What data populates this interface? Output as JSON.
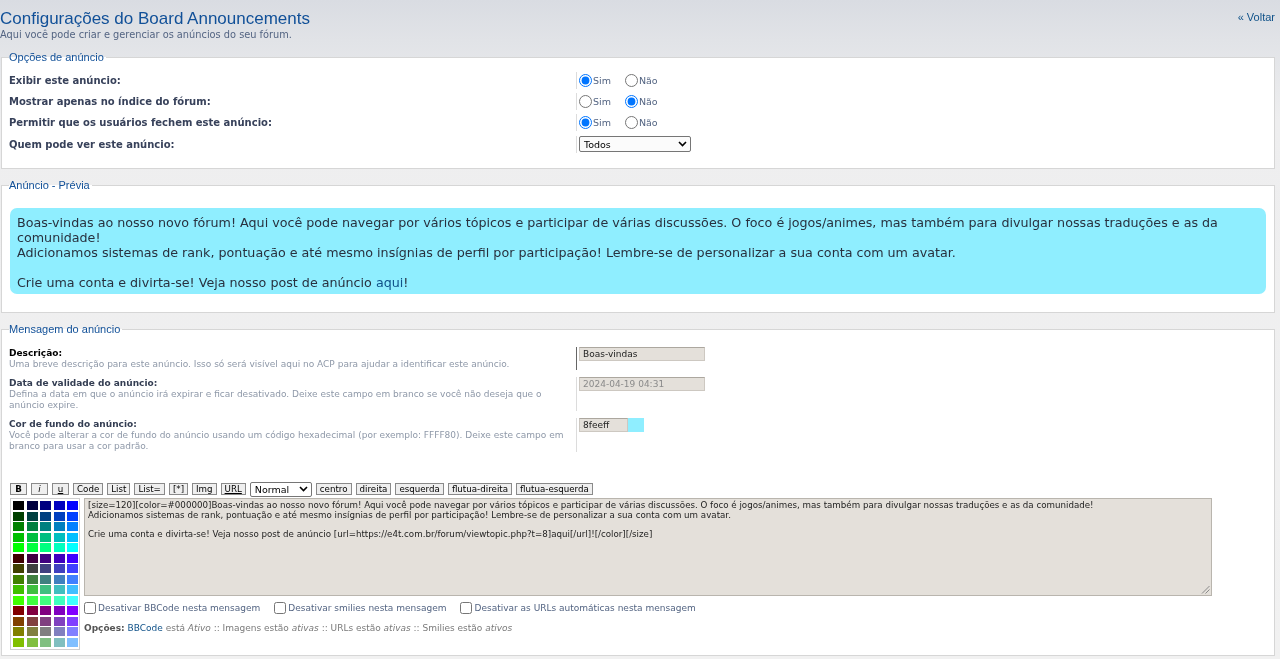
{
  "header": {
    "title": "Configurações do Board Announcements",
    "subtitle": "Aqui você pode criar e gerenciar os anúncios do seu fórum.",
    "back_link": "« Voltar"
  },
  "options": {
    "legend": "Opções de anúncio",
    "rows": [
      {
        "kind": "radio",
        "label": "Exibir este anúncio:",
        "choices": [
          {
            "label": "Sim",
            "selected": true
          },
          {
            "label": "Não",
            "selected": false
          }
        ]
      },
      {
        "kind": "radio",
        "label": "Mostrar apenas no índice do fórum:",
        "choices": [
          {
            "label": "Sim",
            "selected": false
          },
          {
            "label": "Não",
            "selected": true
          }
        ]
      },
      {
        "kind": "radio",
        "label": "Permitir que os usuários fechem este anúncio:",
        "choices": [
          {
            "label": "Sim",
            "selected": true
          },
          {
            "label": "Não",
            "selected": false
          }
        ]
      },
      {
        "kind": "select",
        "label": "Quem pode ver este anúncio:",
        "value": "Todos"
      }
    ]
  },
  "preview": {
    "legend": "Anúncio - Prévia",
    "color": "#8feeff",
    "lines": [
      "Boas-vindas ao nosso novo fórum! Aqui você pode navegar por vários tópicos e participar de várias discussões. O foco é jogos/animes, mas também para divulgar nossas traduções e as da comunidade!",
      "Adicionamos sistemas de rank, pontuação e até mesmo insígnias de perfil por participação! Lembre-se de personalizar a sua conta com um avatar."
    ],
    "closing": {
      "text": "Crie uma conta e divirta-se! Veja nosso post de anúncio",
      "link": "aqui",
      "after": "!"
    }
  },
  "message": {
    "legend": "Mensagem do anúncio",
    "fields": [
      {
        "label": "Descrição:",
        "hint": "Uma breve descrição para este anúncio. Isso só será visível aqui no ACP para ajudar a identificar este anúncio.",
        "value": "Boas-vindas",
        "hovered": true
      },
      {
        "label": "Data de validade do anúncio:",
        "hint": "Defina a data em que o anúncio irá expirar e ficar desativado. Deixe este campo em branco se você não deseja que o anúncio expire.",
        "placeholder": "2024-04-19 04:31",
        "hovered": false
      },
      {
        "label": "Cor de fundo do anúncio:",
        "hint": "Você pode alterar a cor de fundo do anúncio usando um código hexadecimal (por exemplo: FFFF80). Deixe este campo em branco para usar a cor padrão.",
        "value": "8feeff",
        "color": "#8feeff",
        "hovered": false
      }
    ],
    "toolbar": [
      {
        "kind": "bold",
        "label": "B"
      },
      {
        "kind": "italic",
        "label": "i"
      },
      {
        "kind": "underline",
        "label": "u"
      },
      {
        "kind": "plain",
        "label": "Code"
      },
      {
        "kind": "plain",
        "label": "List"
      },
      {
        "kind": "plain",
        "label": "List="
      },
      {
        "kind": "plain",
        "label": "[*]"
      },
      {
        "kind": "plain",
        "label": "Img"
      },
      {
        "kind": "underline",
        "label": "URL"
      },
      {
        "kind": "select",
        "label": "Normal"
      },
      {
        "kind": "plain",
        "label": "centro"
      },
      {
        "kind": "plain",
        "label": "direita"
      },
      {
        "kind": "plain",
        "label": "esquerda"
      },
      {
        "kind": "plain",
        "label": "flutua-direita"
      },
      {
        "kind": "plain",
        "label": "flutua-esquerda"
      }
    ],
    "palette": [
      {
        "color": "#000000"
      },
      {
        "color": "#000040"
      },
      {
        "color": "#000080"
      },
      {
        "color": "#0000bf"
      },
      {
        "color": "#0000ff"
      },
      {
        "color": "#004000"
      },
      {
        "color": "#004040"
      },
      {
        "color": "#004080"
      },
      {
        "color": "#0040bf"
      },
      {
        "color": "#0040ff"
      },
      {
        "color": "#008000"
      },
      {
        "color": "#008040"
      },
      {
        "color": "#008080"
      },
      {
        "color": "#0080bf"
      },
      {
        "color": "#0080ff"
      },
      {
        "color": "#00bf00"
      },
      {
        "color": "#00bf40"
      },
      {
        "color": "#00bf80"
      },
      {
        "color": "#00bfbf"
      },
      {
        "color": "#00bfff"
      },
      {
        "color": "#00ff00"
      },
      {
        "color": "#00ff40"
      },
      {
        "color": "#00ff80"
      },
      {
        "color": "#00ffbf"
      },
      {
        "color": "#00ffff"
      },
      {
        "color": "#400000"
      },
      {
        "color": "#400040"
      },
      {
        "color": "#400080"
      },
      {
        "color": "#4000bf"
      },
      {
        "color": "#4000ff"
      },
      {
        "color": "#404000"
      },
      {
        "color": "#404040"
      },
      {
        "color": "#404080"
      },
      {
        "color": "#4040bf"
      },
      {
        "color": "#4040ff"
      },
      {
        "color": "#408000"
      },
      {
        "color": "#408040"
      },
      {
        "color": "#408080"
      },
      {
        "color": "#4080bf"
      },
      {
        "color": "#4080ff"
      },
      {
        "color": "#40bf00"
      },
      {
        "color": "#40bf40"
      },
      {
        "color": "#40bf80"
      },
      {
        "color": "#40bfbf"
      },
      {
        "color": "#40bfff"
      },
      {
        "color": "#40ff00"
      },
      {
        "color": "#40ff40"
      },
      {
        "color": "#40ff80"
      },
      {
        "color": "#40ffbf"
      },
      {
        "color": "#40ffff"
      },
      {
        "color": "#800000"
      },
      {
        "color": "#800040"
      },
      {
        "color": "#800080"
      },
      {
        "color": "#8000bf"
      },
      {
        "color": "#8000ff"
      },
      {
        "color": "#804000"
      },
      {
        "color": "#804040"
      },
      {
        "color": "#804080"
      },
      {
        "color": "#8040bf"
      },
      {
        "color": "#8040ff"
      },
      {
        "color": "#808000"
      },
      {
        "color": "#808040"
      },
      {
        "color": "#808080"
      },
      {
        "color": "#8080bf"
      },
      {
        "color": "#8080ff"
      },
      {
        "color": "#80bf00"
      },
      {
        "color": "#80bf40"
      },
      {
        "color": "#80bf80"
      },
      {
        "color": "#80bfbf"
      },
      {
        "color": "#80bfff"
      }
    ],
    "text": "[size=120][color=#000000]Boas-vindas ao nosso novo fórum! Aqui você pode navegar por vários tópicos e participar de várias discussões. O foco é jogos/animes, mas também para divulgar nossas traduções e as da comunidade!\nAdicionamos sistemas de rank, pontuação e até mesmo insígnias de perfil por participação! Lembre-se de personalizar a sua conta com um avatar.\n\nCrie uma conta e divirta-se! Veja nosso post de anúncio [url=https://e4t.com.br/forum/viewtopic.php?t=8]aqui[/url]![/color][/size]",
    "checkboxes": [
      {
        "label": "Desativar BBCode nesta mensagem",
        "checked": false
      },
      {
        "label": "Desativar smilies nesta mensagem",
        "checked": false
      },
      {
        "label": "Desativar as URLs automáticas nesta mensagem",
        "checked": false
      }
    ],
    "options_line": {
      "label": "Opções:",
      "link": "BBCode",
      "text": "está *Ativo* :: Imagens estão *ativas* :: URLs estão *ativas* :: Smilies estão *ativos*"
    }
  }
}
